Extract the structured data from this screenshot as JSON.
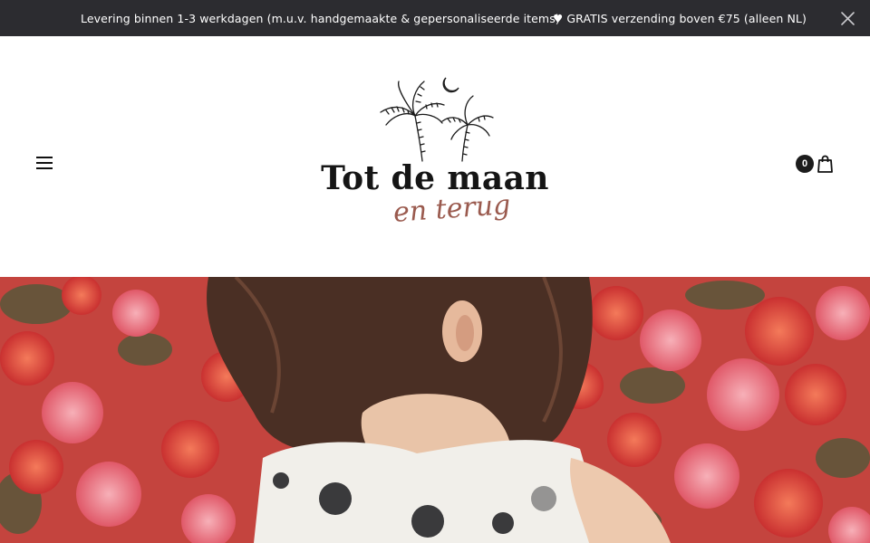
{
  "announcement": {
    "messages": [
      "Levering binnen 1-3 werkdagen (m.u.v. handgemaakte & gepersonaliseerde items)",
      "♥ GRATIS verzending boven €75 (alleen NL)"
    ],
    "close_icon": "close-icon"
  },
  "header": {
    "menu_icon": "hamburger-menu-icon",
    "logo": {
      "title": "Tot de maan",
      "script": "en terug",
      "icon": "palm-trees-moon-icon"
    },
    "cart": {
      "count": "0",
      "icon": "shopping-bag-icon"
    }
  },
  "colors": {
    "announcement_bg": "#2c2c30",
    "text_primary": "#151515",
    "logo_script": "#9a5a4e"
  },
  "hero": {
    "image": "child-with-bougainvillea-flowers-photo"
  }
}
